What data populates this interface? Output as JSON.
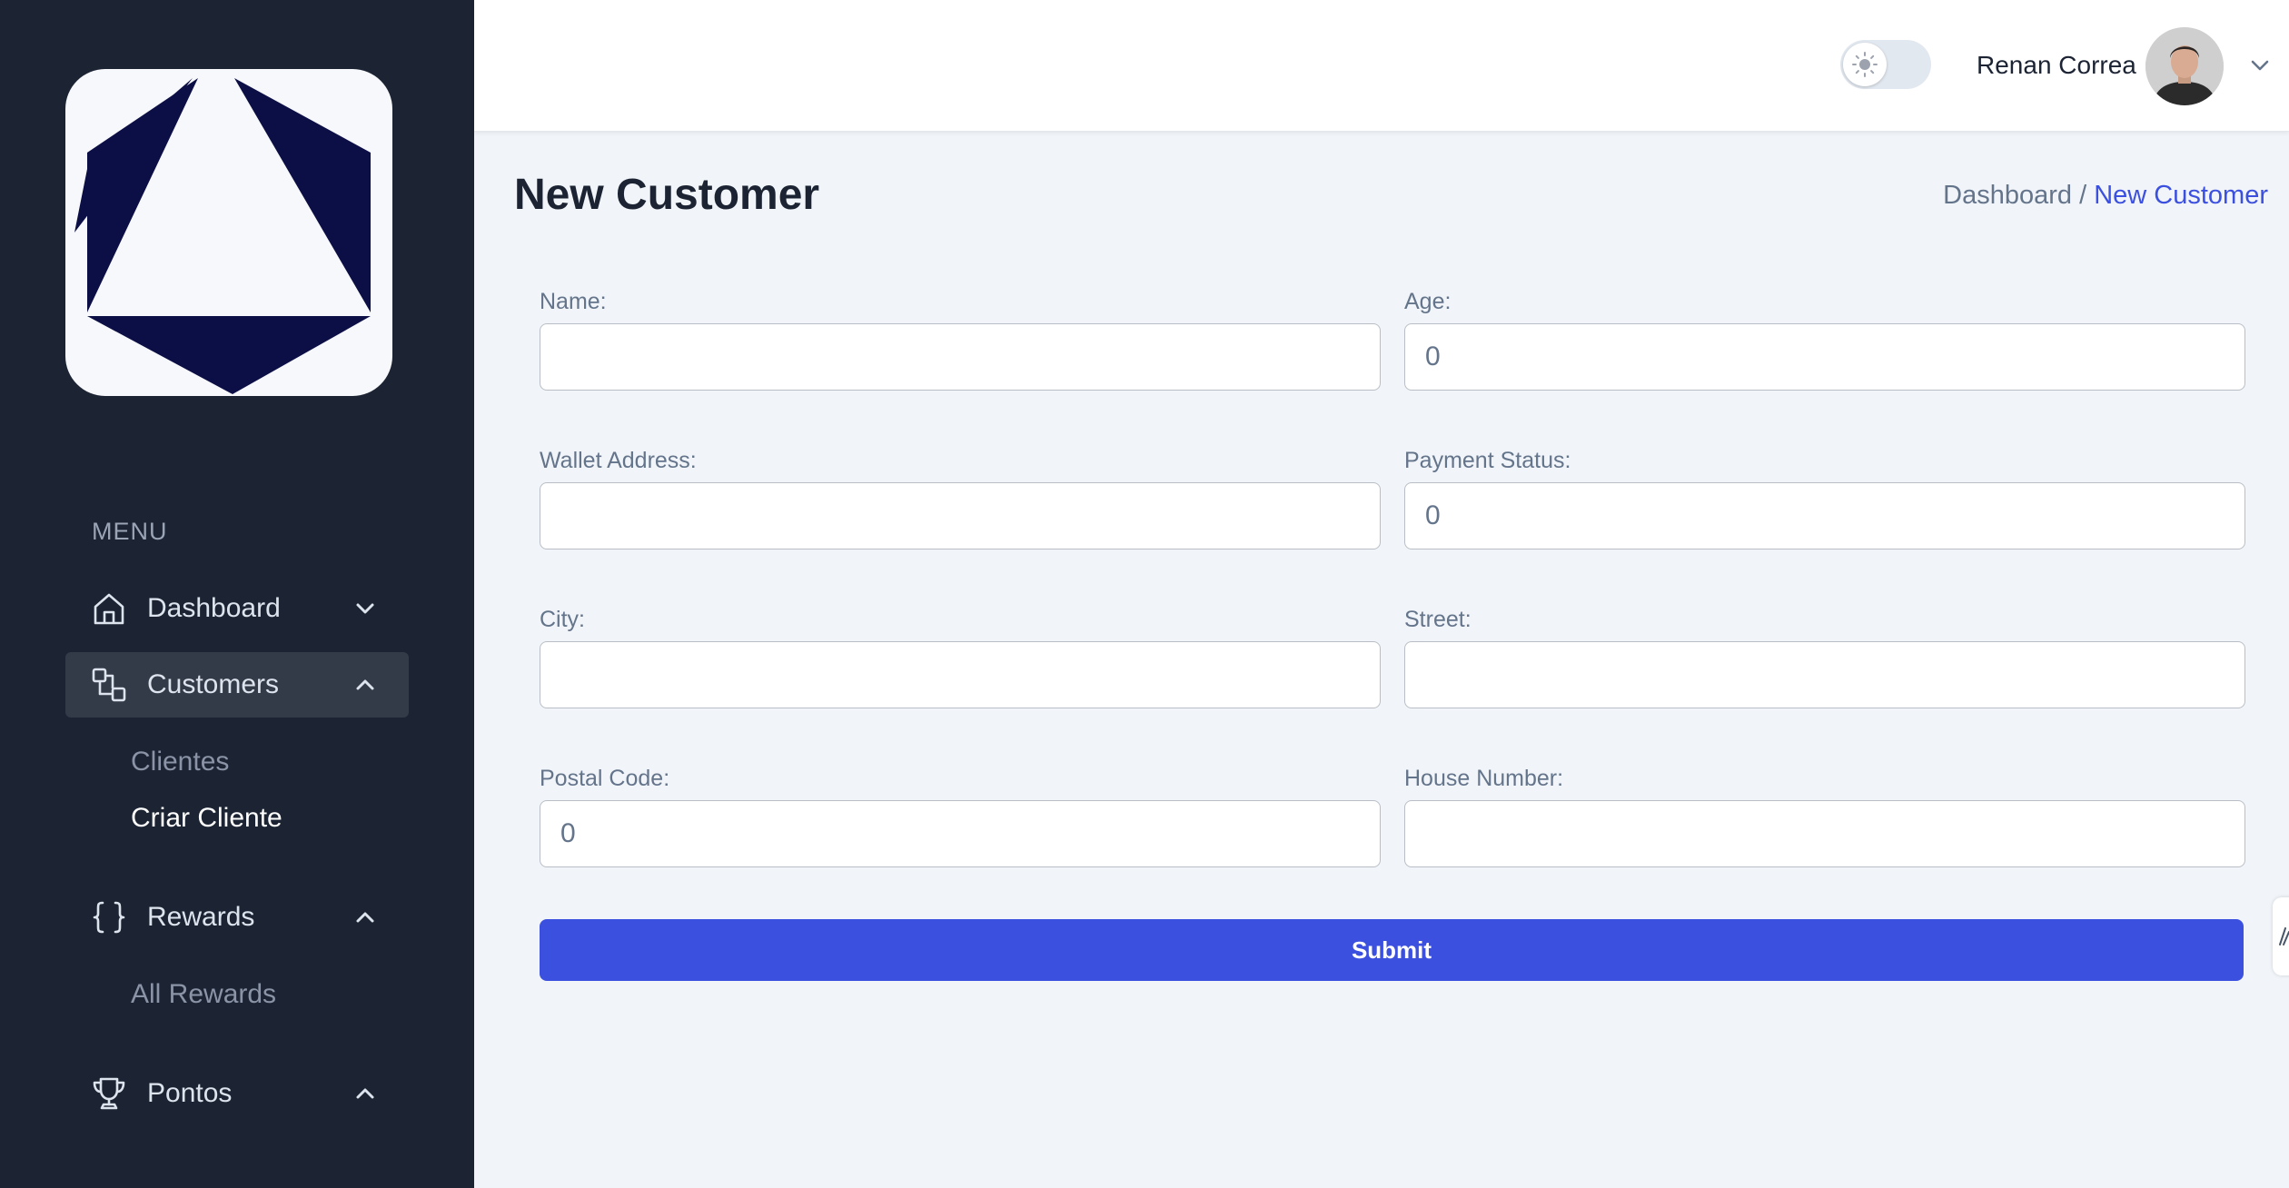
{
  "colors": {
    "sidebar_bg": "#1c2434",
    "accent": "#3c50e0",
    "page_bg": "#f1f5f9",
    "logo_fill": "#0c0f45"
  },
  "sidebar": {
    "logo_icon": "triangle-hexagon-logo",
    "menu_heading": "MENU",
    "items": [
      {
        "label": "Dashboard",
        "icon": "home-icon",
        "expanded": false,
        "active": false,
        "children": []
      },
      {
        "label": "Customers",
        "icon": "customers-icon",
        "expanded": true,
        "active": true,
        "children": [
          "Clientes",
          "Criar Cliente"
        ]
      },
      {
        "label": "Rewards",
        "icon": "braces-icon",
        "expanded": true,
        "active": false,
        "children": [
          "All Rewards"
        ]
      },
      {
        "label": "Pontos",
        "icon": "trophy-icon",
        "expanded": true,
        "active": false,
        "children": []
      }
    ]
  },
  "header": {
    "theme_toggle_icon": "sun-icon",
    "user_name": "Renan Correa",
    "avatar_icon": "user-avatar"
  },
  "main": {
    "page_title": "New Customer",
    "breadcrumb": {
      "root": "Dashboard /",
      "current": "New Customer"
    },
    "form": {
      "name": {
        "label": "Name:",
        "value": ""
      },
      "age": {
        "label": "Age:",
        "value": "0"
      },
      "wallet_address": {
        "label": "Wallet Address:",
        "value": ""
      },
      "payment_status": {
        "label": "Payment Status:",
        "value": "0"
      },
      "city": {
        "label": "City:",
        "value": ""
      },
      "street": {
        "label": "Street:",
        "value": ""
      },
      "postal_code": {
        "label": "Postal Code:",
        "value": "0"
      },
      "house_number": {
        "label": "House Number:",
        "value": ""
      }
    },
    "submit_label": "Submit"
  }
}
